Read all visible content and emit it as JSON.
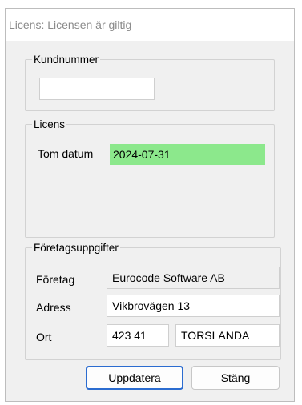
{
  "window": {
    "title": "Licens: Licensen är giltig"
  },
  "customer": {
    "group_label": "Kundnummer",
    "number_value": ""
  },
  "license": {
    "group_label": "Licens",
    "tom_label": "Tom datum",
    "tom_value": "2024-07-31",
    "valid_color": "#8ce88c"
  },
  "company": {
    "group_label": "Företagsuppgifter",
    "company_label": "Företag",
    "company_value": "Eurocode Software AB",
    "address_label": "Adress",
    "address_value": "Vikbrovägen 13",
    "city_label": "Ort",
    "postal_code_value": "423 41",
    "city_value": "TORSLANDA"
  },
  "buttons": {
    "update_label": "Uppdatera",
    "close_label": "Stäng",
    "accent": "#2b6cd0"
  }
}
